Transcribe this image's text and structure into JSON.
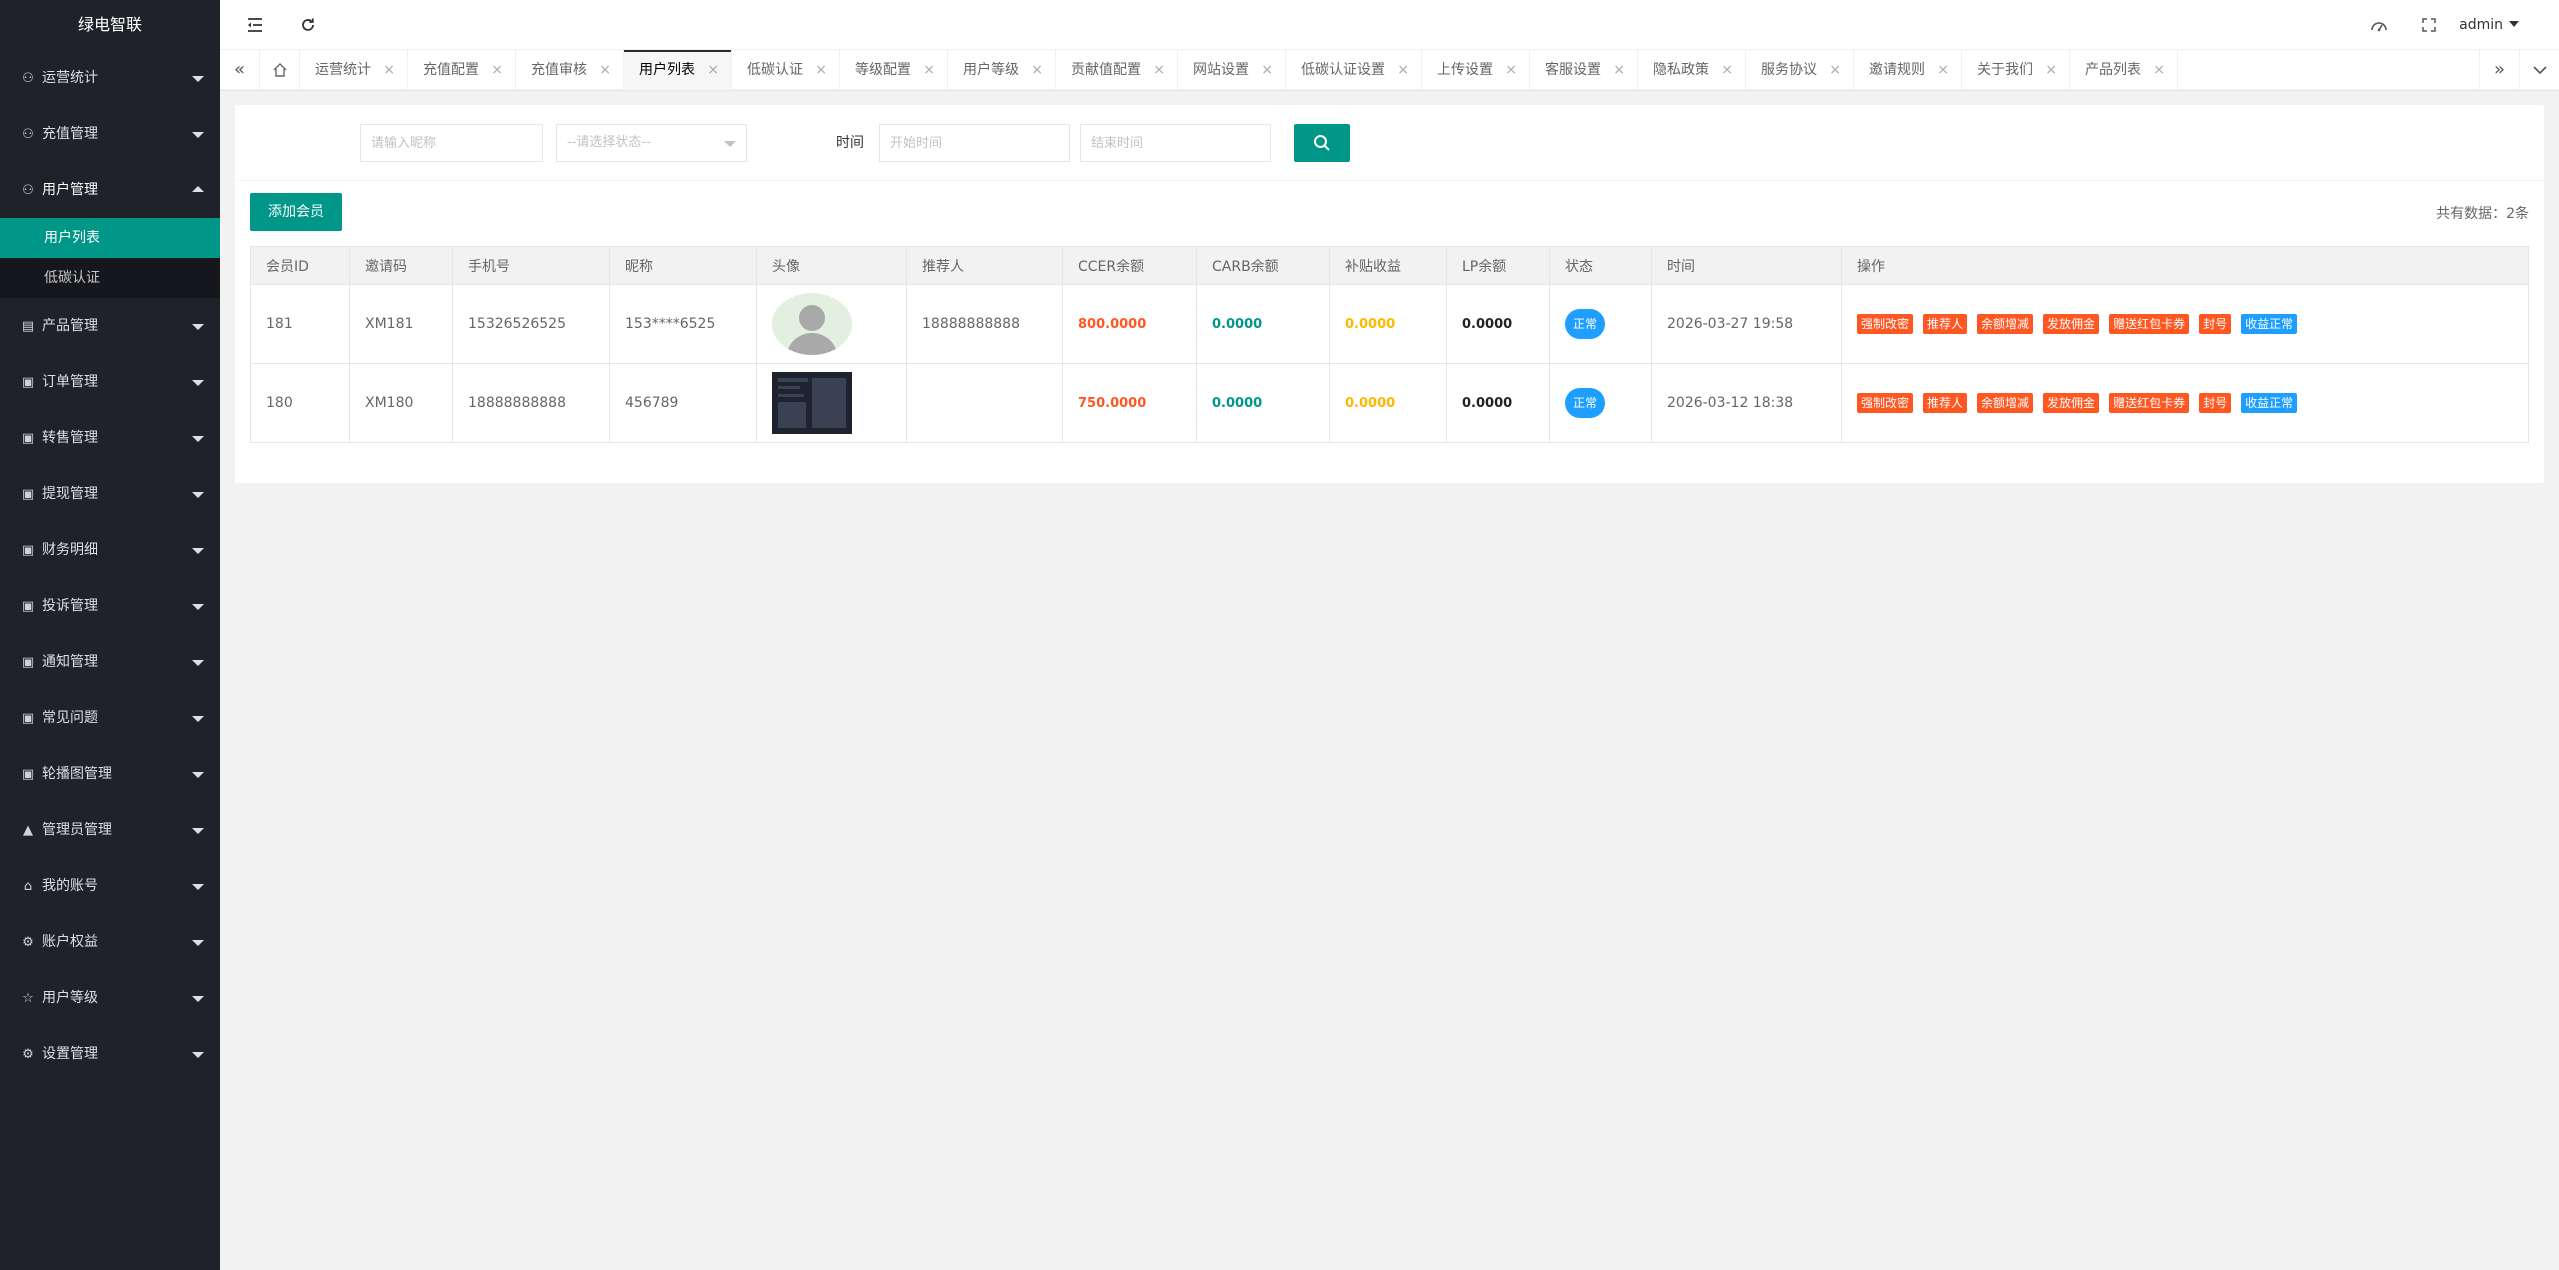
{
  "app": {
    "title": "绿电智联"
  },
  "sidebar": {
    "items": [
      {
        "label": "运营统计",
        "icon": "user-icon",
        "glyph": "⚇",
        "expanded": false
      },
      {
        "label": "充值管理",
        "icon": "user-icon",
        "glyph": "⚇",
        "expanded": false
      },
      {
        "label": "用户管理",
        "icon": "user-icon",
        "glyph": "⚇",
        "expanded": true,
        "children": [
          {
            "label": "用户列表",
            "active": true
          },
          {
            "label": "低碳认证",
            "active": false
          }
        ]
      },
      {
        "label": "产品管理",
        "icon": "document-icon",
        "glyph": "▤",
        "expanded": false
      },
      {
        "label": "订单管理",
        "icon": "image-icon",
        "glyph": "▣",
        "expanded": false
      },
      {
        "label": "转售管理",
        "icon": "image-icon",
        "glyph": "▣",
        "expanded": false
      },
      {
        "label": "提现管理",
        "icon": "image-icon",
        "glyph": "▣",
        "expanded": false
      },
      {
        "label": "财务明细",
        "icon": "image-icon",
        "glyph": "▣",
        "expanded": false
      },
      {
        "label": "投诉管理",
        "icon": "image-icon",
        "glyph": "▣",
        "expanded": false
      },
      {
        "label": "通知管理",
        "icon": "image-icon",
        "glyph": "▣",
        "expanded": false
      },
      {
        "label": "常见问题",
        "icon": "image-icon",
        "glyph": "▣",
        "expanded": false
      },
      {
        "label": "轮播图管理",
        "icon": "image-icon",
        "glyph": "▣",
        "expanded": false
      },
      {
        "label": "管理员管理",
        "icon": "person-icon",
        "glyph": "▲",
        "expanded": false
      },
      {
        "label": "我的账号",
        "icon": "home-icon",
        "glyph": "⌂",
        "expanded": false
      },
      {
        "label": "账户权益",
        "icon": "gear-icon",
        "glyph": "⚙",
        "expanded": false
      },
      {
        "label": "用户等级",
        "icon": "star-icon",
        "glyph": "☆",
        "expanded": false
      },
      {
        "label": "设置管理",
        "icon": "settings-icon",
        "glyph": "⚙",
        "expanded": false
      }
    ]
  },
  "header": {
    "user": "admin",
    "icons": [
      "menu-toggle-icon",
      "refresh-icon",
      "theme-icon",
      "fullscreen-icon"
    ]
  },
  "tabs": {
    "items": [
      {
        "label": "运营统计",
        "active": false
      },
      {
        "label": "充值配置",
        "active": false
      },
      {
        "label": "充值审核",
        "active": false
      },
      {
        "label": "用户列表",
        "active": true
      },
      {
        "label": "低碳认证",
        "active": false
      },
      {
        "label": "等级配置",
        "active": false
      },
      {
        "label": "用户等级",
        "active": false
      },
      {
        "label": "贡献值配置",
        "active": false
      },
      {
        "label": "网站设置",
        "active": false
      },
      {
        "label": "低碳认证设置",
        "active": false
      },
      {
        "label": "上传设置",
        "active": false
      },
      {
        "label": "客服设置",
        "active": false
      },
      {
        "label": "隐私政策",
        "active": false
      },
      {
        "label": "服务协议",
        "active": false
      },
      {
        "label": "邀请规则",
        "active": false
      },
      {
        "label": "关于我们",
        "active": false
      },
      {
        "label": "产品列表",
        "active": false
      }
    ],
    "close_glyph": "×"
  },
  "filters": {
    "nickname_placeholder": "请输入昵称",
    "status_placeholder": "--请选择状态--",
    "time_label": "时间",
    "start_placeholder": "开始时间",
    "end_placeholder": "结束时间"
  },
  "toolbar": {
    "add_label": "添加会员",
    "total_text": "共有数据：2条"
  },
  "table": {
    "headers": [
      "会员ID",
      "邀请码",
      "手机号",
      "昵称",
      "头像",
      "推荐人",
      "CCER余额",
      "CARB余额",
      "补贴收益",
      "LP余额",
      "状态",
      "时间",
      "操作"
    ],
    "rows": [
      {
        "id": "181",
        "invite": "XM181",
        "phone": "15326526525",
        "nickname": "153****6525",
        "avatar": "default-avatar",
        "referrer": "18888888888",
        "ccer": "800.0000",
        "carb": "0.0000",
        "subsidy": "0.0000",
        "lp": "0.0000",
        "status": "正常",
        "time": "2026-03-27 19:58"
      },
      {
        "id": "180",
        "invite": "XM180",
        "phone": "18888888888",
        "nickname": "456789",
        "avatar": "screenshot-avatar",
        "referrer": "",
        "ccer": "750.0000",
        "carb": "0.0000",
        "subsidy": "0.0000",
        "lp": "0.0000",
        "status": "正常",
        "time": "2026-03-12 18:38"
      }
    ],
    "actions": [
      {
        "label": "强制改密",
        "color": "#ff5722"
      },
      {
        "label": "推荐人",
        "color": "#ff5722"
      },
      {
        "label": "余额增减",
        "color": "#ff5722"
      },
      {
        "label": "发放佣金",
        "color": "#ff5722"
      },
      {
        "label": "赠送红包卡券",
        "color": "#ff5722"
      },
      {
        "label": "封号",
        "color": "#ff5722"
      },
      {
        "label": "收益正常",
        "color": "#1e9fff"
      }
    ]
  },
  "colors": {
    "accent": "#009688",
    "sidebar": "#20222a",
    "danger": "#ff5722",
    "info": "#1e9fff",
    "warn": "#ffb800"
  }
}
